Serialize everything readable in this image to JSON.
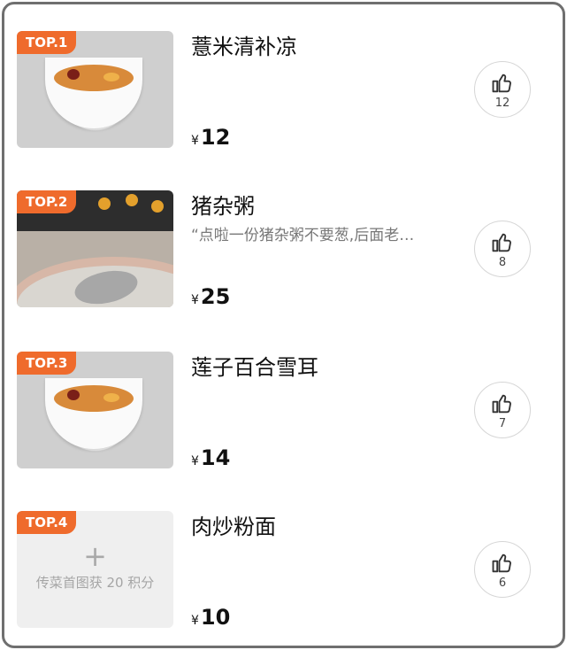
{
  "items": [
    {
      "badge": "TOP.1",
      "name": "薏米清补凉",
      "review": "",
      "price": "12",
      "likes": "12",
      "currency": "¥"
    },
    {
      "badge": "TOP.2",
      "name": "猪杂粥",
      "review": "“点啦一份猪杂粥不要葱,后面老…",
      "price": "25",
      "likes": "8",
      "currency": "¥"
    },
    {
      "badge": "TOP.3",
      "name": "莲子百合雪耳",
      "review": "",
      "price": "14",
      "likes": "7",
      "currency": "¥"
    },
    {
      "badge": "TOP.4",
      "name": "肉炒粉面",
      "review": "",
      "price": "10",
      "likes": "6",
      "currency": "¥",
      "placeholder_text": "传菜首图获 20 积分",
      "placeholder_icon": "plus-icon"
    }
  ],
  "icons": {
    "like": "thumb-up-icon"
  },
  "colors": {
    "badge": "#ef6b2c"
  }
}
